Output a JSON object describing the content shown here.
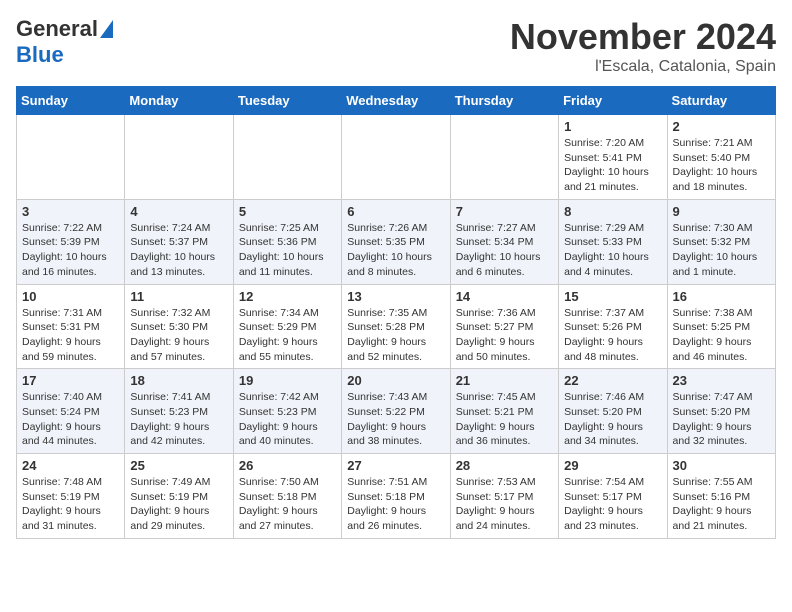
{
  "header": {
    "logo_general": "General",
    "logo_blue": "Blue",
    "month_title": "November 2024",
    "location": "l'Escala, Catalonia, Spain"
  },
  "weekdays": [
    "Sunday",
    "Monday",
    "Tuesday",
    "Wednesday",
    "Thursday",
    "Friday",
    "Saturday"
  ],
  "weeks": [
    [
      {
        "day": "",
        "info": ""
      },
      {
        "day": "",
        "info": ""
      },
      {
        "day": "",
        "info": ""
      },
      {
        "day": "",
        "info": ""
      },
      {
        "day": "",
        "info": ""
      },
      {
        "day": "1",
        "info": "Sunrise: 7:20 AM\nSunset: 5:41 PM\nDaylight: 10 hours and 21 minutes."
      },
      {
        "day": "2",
        "info": "Sunrise: 7:21 AM\nSunset: 5:40 PM\nDaylight: 10 hours and 18 minutes."
      }
    ],
    [
      {
        "day": "3",
        "info": "Sunrise: 7:22 AM\nSunset: 5:39 PM\nDaylight: 10 hours and 16 minutes."
      },
      {
        "day": "4",
        "info": "Sunrise: 7:24 AM\nSunset: 5:37 PM\nDaylight: 10 hours and 13 minutes."
      },
      {
        "day": "5",
        "info": "Sunrise: 7:25 AM\nSunset: 5:36 PM\nDaylight: 10 hours and 11 minutes."
      },
      {
        "day": "6",
        "info": "Sunrise: 7:26 AM\nSunset: 5:35 PM\nDaylight: 10 hours and 8 minutes."
      },
      {
        "day": "7",
        "info": "Sunrise: 7:27 AM\nSunset: 5:34 PM\nDaylight: 10 hours and 6 minutes."
      },
      {
        "day": "8",
        "info": "Sunrise: 7:29 AM\nSunset: 5:33 PM\nDaylight: 10 hours and 4 minutes."
      },
      {
        "day": "9",
        "info": "Sunrise: 7:30 AM\nSunset: 5:32 PM\nDaylight: 10 hours and 1 minute."
      }
    ],
    [
      {
        "day": "10",
        "info": "Sunrise: 7:31 AM\nSunset: 5:31 PM\nDaylight: 9 hours and 59 minutes."
      },
      {
        "day": "11",
        "info": "Sunrise: 7:32 AM\nSunset: 5:30 PM\nDaylight: 9 hours and 57 minutes."
      },
      {
        "day": "12",
        "info": "Sunrise: 7:34 AM\nSunset: 5:29 PM\nDaylight: 9 hours and 55 minutes."
      },
      {
        "day": "13",
        "info": "Sunrise: 7:35 AM\nSunset: 5:28 PM\nDaylight: 9 hours and 52 minutes."
      },
      {
        "day": "14",
        "info": "Sunrise: 7:36 AM\nSunset: 5:27 PM\nDaylight: 9 hours and 50 minutes."
      },
      {
        "day": "15",
        "info": "Sunrise: 7:37 AM\nSunset: 5:26 PM\nDaylight: 9 hours and 48 minutes."
      },
      {
        "day": "16",
        "info": "Sunrise: 7:38 AM\nSunset: 5:25 PM\nDaylight: 9 hours and 46 minutes."
      }
    ],
    [
      {
        "day": "17",
        "info": "Sunrise: 7:40 AM\nSunset: 5:24 PM\nDaylight: 9 hours and 44 minutes."
      },
      {
        "day": "18",
        "info": "Sunrise: 7:41 AM\nSunset: 5:23 PM\nDaylight: 9 hours and 42 minutes."
      },
      {
        "day": "19",
        "info": "Sunrise: 7:42 AM\nSunset: 5:23 PM\nDaylight: 9 hours and 40 minutes."
      },
      {
        "day": "20",
        "info": "Sunrise: 7:43 AM\nSunset: 5:22 PM\nDaylight: 9 hours and 38 minutes."
      },
      {
        "day": "21",
        "info": "Sunrise: 7:45 AM\nSunset: 5:21 PM\nDaylight: 9 hours and 36 minutes."
      },
      {
        "day": "22",
        "info": "Sunrise: 7:46 AM\nSunset: 5:20 PM\nDaylight: 9 hours and 34 minutes."
      },
      {
        "day": "23",
        "info": "Sunrise: 7:47 AM\nSunset: 5:20 PM\nDaylight: 9 hours and 32 minutes."
      }
    ],
    [
      {
        "day": "24",
        "info": "Sunrise: 7:48 AM\nSunset: 5:19 PM\nDaylight: 9 hours and 31 minutes."
      },
      {
        "day": "25",
        "info": "Sunrise: 7:49 AM\nSunset: 5:19 PM\nDaylight: 9 hours and 29 minutes."
      },
      {
        "day": "26",
        "info": "Sunrise: 7:50 AM\nSunset: 5:18 PM\nDaylight: 9 hours and 27 minutes."
      },
      {
        "day": "27",
        "info": "Sunrise: 7:51 AM\nSunset: 5:18 PM\nDaylight: 9 hours and 26 minutes."
      },
      {
        "day": "28",
        "info": "Sunrise: 7:53 AM\nSunset: 5:17 PM\nDaylight: 9 hours and 24 minutes."
      },
      {
        "day": "29",
        "info": "Sunrise: 7:54 AM\nSunset: 5:17 PM\nDaylight: 9 hours and 23 minutes."
      },
      {
        "day": "30",
        "info": "Sunrise: 7:55 AM\nSunset: 5:16 PM\nDaylight: 9 hours and 21 minutes."
      }
    ]
  ]
}
